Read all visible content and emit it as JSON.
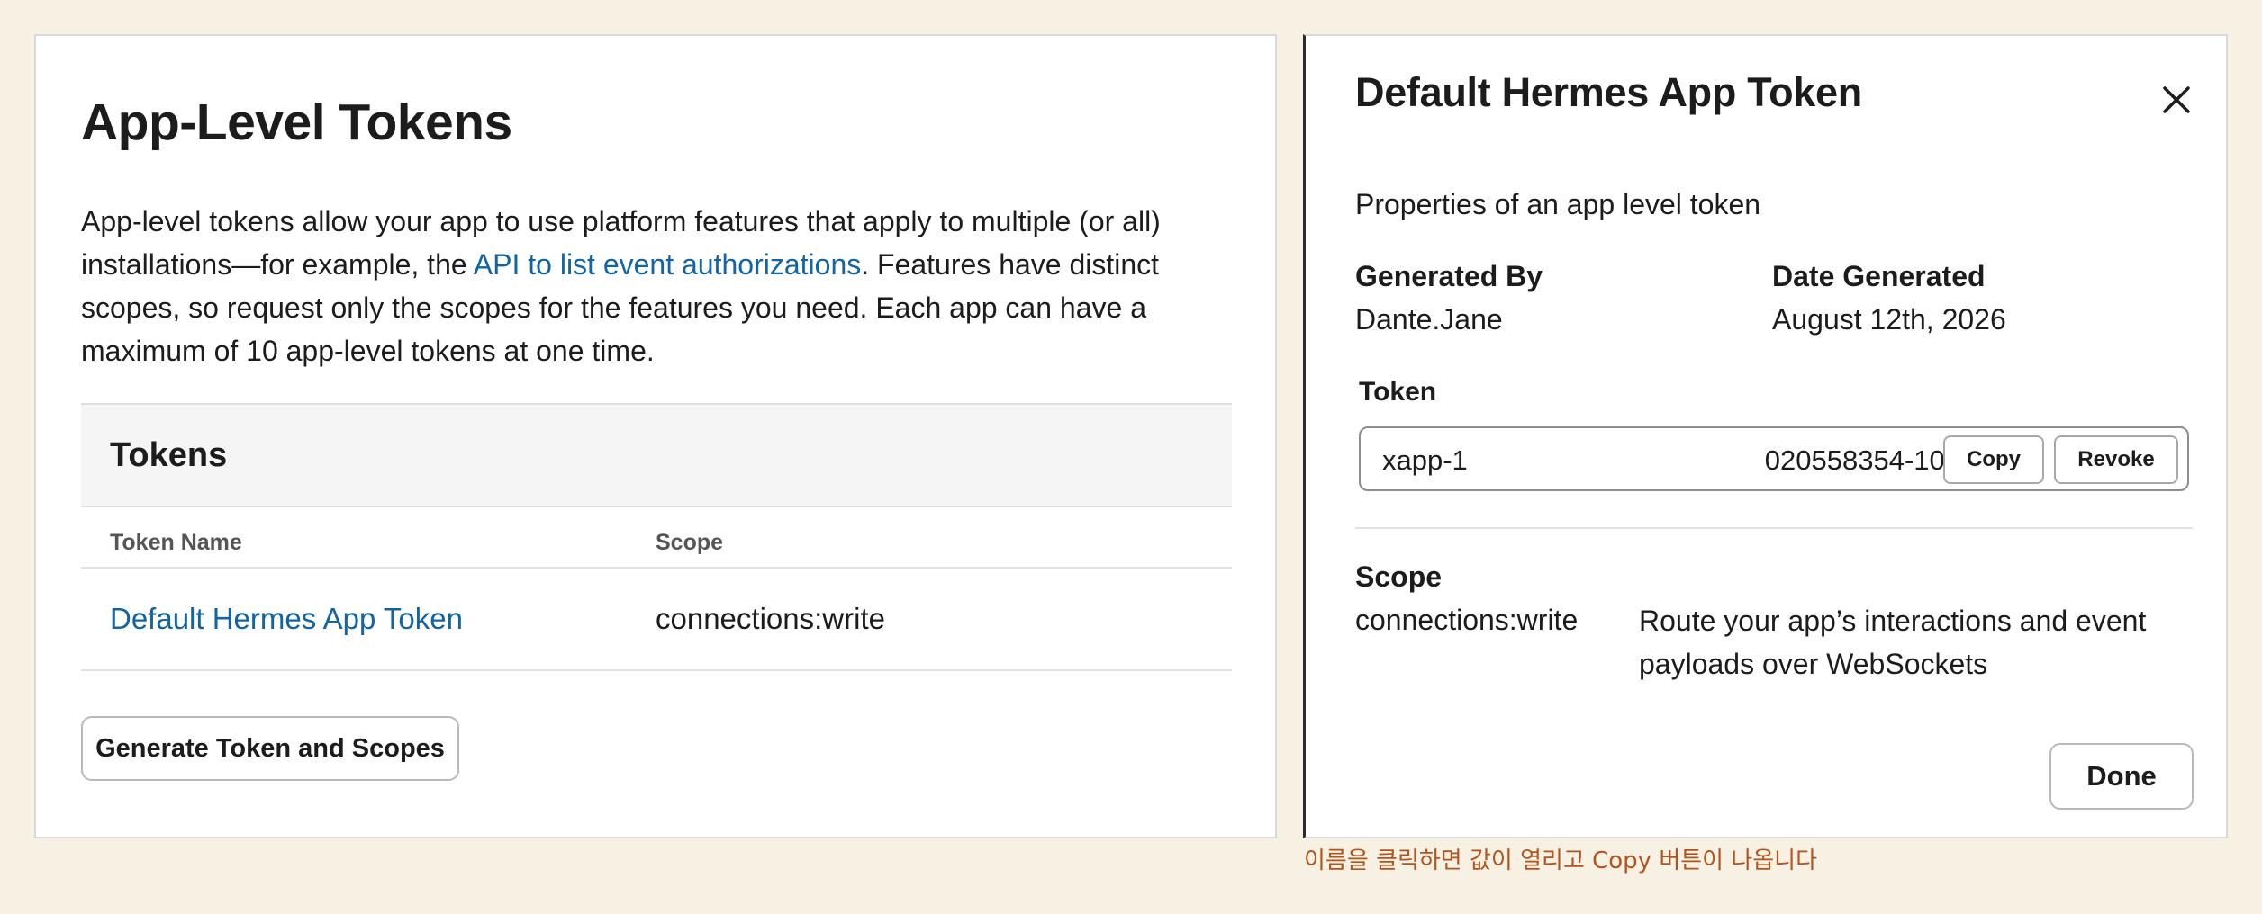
{
  "left": {
    "title": "App-Level Tokens",
    "description_part1": "App-level tokens allow your app to use platform features that apply to multiple (or all) installations—for example, the ",
    "description_link": "API to list event authorizations",
    "description_part2": ". Features have distinct scopes, so request only the scopes for the features you need. Each app can have a maximum of 10 app-level tokens at one time.",
    "tokens_header": "Tokens",
    "columns": {
      "name": "Token Name",
      "scope": "Scope"
    },
    "rows": [
      {
        "name": "Default Hermes App Token",
        "scope": "connections:write"
      }
    ],
    "generate_button": "Generate Token and Scopes"
  },
  "modal": {
    "title": "Default Hermes App Token",
    "subtitle": "Properties of an app level token",
    "generated_by_label": "Generated By",
    "generated_by_value": "Dante.Jane",
    "date_label": "Date Generated",
    "date_value": "August 12th, 2026",
    "token_label": "Token",
    "token_prefix": "xapp-1",
    "token_suffix": "020558354-10f",
    "copy_button": "Copy",
    "revoke_button": "Revoke",
    "scope_label": "Scope",
    "scope_value": "connections:write",
    "scope_description": "Route your app’s interactions and event payloads over WebSockets",
    "done_button": "Done"
  },
  "caption": "이름을 클릭하면 값이 열리고 Copy 버튼이 나옵니다",
  "icons": {
    "close": "close-icon"
  },
  "colors": {
    "link": "#1264a3",
    "background": "#f6f1e3",
    "caption": "#b3541e"
  }
}
